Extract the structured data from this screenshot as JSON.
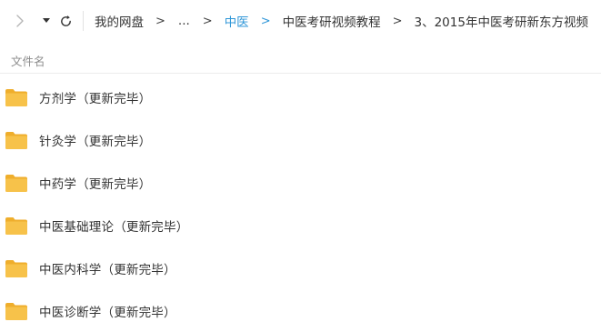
{
  "toolbar": {
    "back_icon": "chevron-right-icon",
    "dropdown_icon": "caret-down-icon",
    "refresh_icon": "refresh-icon"
  },
  "breadcrumb": {
    "items": [
      {
        "label": "我的网盘"
      },
      {
        "label": "..."
      },
      {
        "label": "中医",
        "active": true
      },
      {
        "label": "中医考研视频教程"
      },
      {
        "label": "3、2015年中医考研新东方视频"
      }
    ],
    "separator": ">"
  },
  "columns": {
    "name": "文件名"
  },
  "files": [
    {
      "name": "方剂学（更新完毕）",
      "icon": "folder-icon"
    },
    {
      "name": "针灸学（更新完毕）",
      "icon": "folder-icon"
    },
    {
      "name": "中药学（更新完毕）",
      "icon": "folder-icon"
    },
    {
      "name": "中医基础理论（更新完毕）",
      "icon": "folder-icon"
    },
    {
      "name": "中医内科学（更新完毕）",
      "icon": "folder-icon"
    },
    {
      "name": "中医诊断学（更新完毕）",
      "icon": "folder-icon"
    }
  ],
  "colors": {
    "accent": "#3097d8",
    "folder": "#f7c24a",
    "folder_tab": "#efae2c",
    "text": "#333333",
    "muted": "#8c8c8c"
  }
}
